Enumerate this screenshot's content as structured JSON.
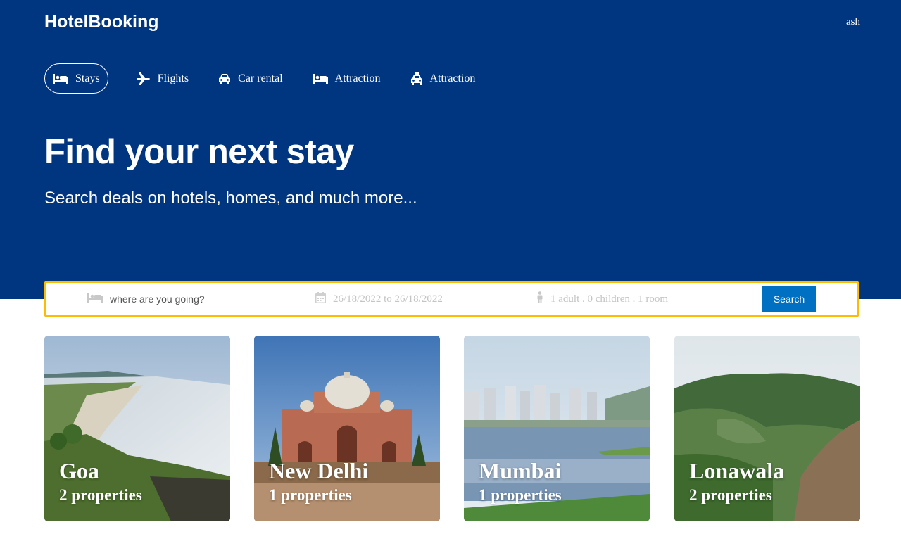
{
  "app": {
    "logo": "HotelBooking",
    "user": "ash"
  },
  "nav": {
    "items": [
      {
        "label": "Stays",
        "icon": "bed-icon",
        "active": true
      },
      {
        "label": "Flights",
        "icon": "plane-icon",
        "active": false
      },
      {
        "label": "Car rental",
        "icon": "car-icon",
        "active": false
      },
      {
        "label": "Attraction",
        "icon": "bed-icon",
        "active": false
      },
      {
        "label": "Attraction",
        "icon": "taxi-icon",
        "active": false
      }
    ]
  },
  "hero": {
    "title": "Find your next stay",
    "subtitle": "Search deals on hotels, homes, and much more..."
  },
  "search": {
    "destination_placeholder": "where are you going?",
    "dates": "26/18/2022 to 26/18/2022",
    "guests": "1 adult . 0 children . 1 room",
    "button_label": "Search"
  },
  "cities": [
    {
      "name": "Goa",
      "properties": "2 properties"
    },
    {
      "name": "New Delhi",
      "properties": "1 properties"
    },
    {
      "name": "Mumbai",
      "properties": "1 properties"
    },
    {
      "name": "Lonawala",
      "properties": "2 properties"
    }
  ],
  "colors": {
    "brand": "#003580",
    "search_border": "#febb02",
    "button": "#0071c2"
  }
}
